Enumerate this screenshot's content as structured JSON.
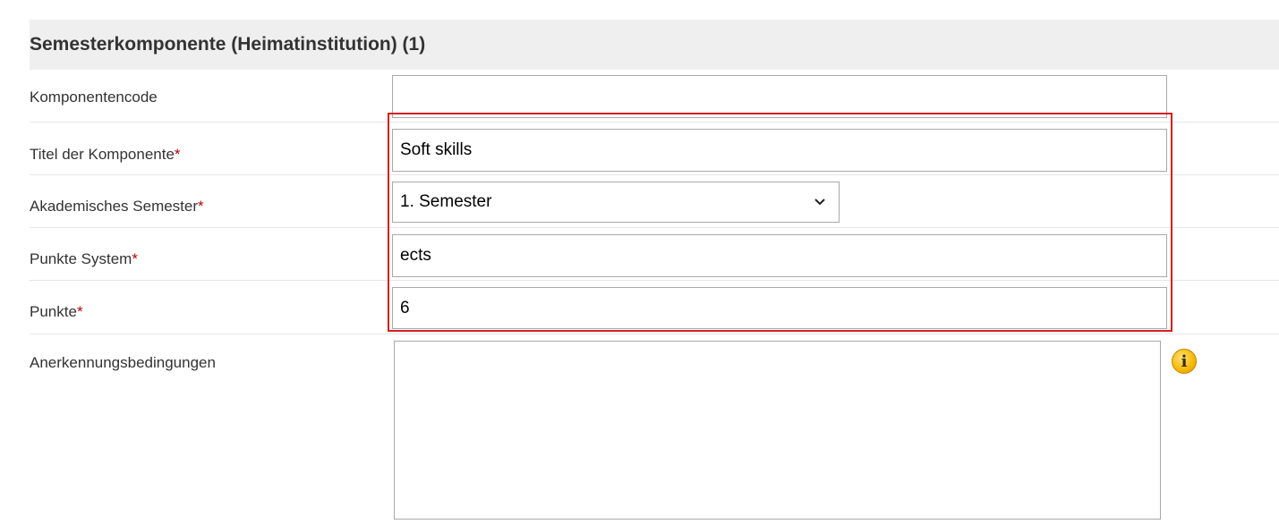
{
  "section": {
    "title": "Semesterkomponente (Heimatinstitution) (1)"
  },
  "fields": {
    "komponentencode": {
      "label": "Komponentencode",
      "value": ""
    },
    "titel": {
      "label": "Titel der Komponente",
      "required_mark": "*",
      "value": "Soft skills"
    },
    "semester": {
      "label": "Akademisches Semester",
      "required_mark": "*",
      "value": "1. Semester"
    },
    "punkte_system": {
      "label": "Punkte System",
      "required_mark": "*",
      "value": "ects"
    },
    "punkte": {
      "label": "Punkte",
      "required_mark": "*",
      "value": "6"
    },
    "anerkennung": {
      "label": "Anerkennungsbedingungen",
      "value": ""
    }
  },
  "icons": {
    "info": "info-icon"
  },
  "colors": {
    "required": "#c00000",
    "highlight": "#d42020",
    "header_bg": "#efefef",
    "info": "#f5b800"
  }
}
